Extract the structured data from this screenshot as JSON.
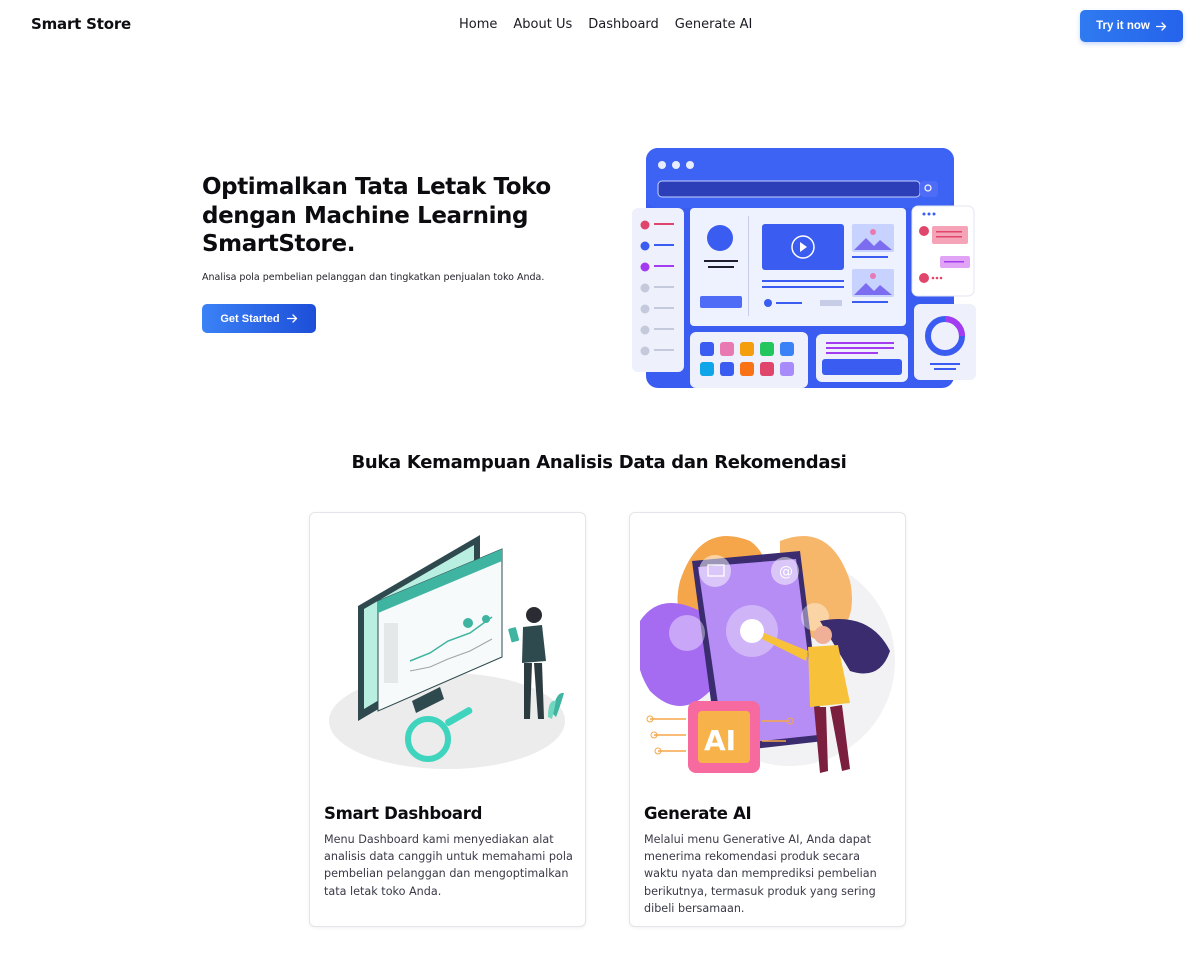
{
  "nav": {
    "brand": "Smart Store",
    "links": [
      "Home",
      "About Us",
      "Dashboard",
      "Generate AI"
    ],
    "cta_label": "Try it now",
    "cta_icon": "arrow-right-icon"
  },
  "hero": {
    "title": "Optimalkan Tata Letak Toko dengan Machine Learning SmartStore.",
    "subtitle": "Analisa pola pembelian pelanggan dan tingkatkan penjualan toko Anda.",
    "button_label": "Get Started",
    "button_icon": "arrow-right-icon",
    "illustration": "dashboard-ui-illustration"
  },
  "features": {
    "title": "Buka Kemampuan Analisis Data dan Rekomendasi",
    "cards": [
      {
        "title": "Smart Dashboard",
        "text": "Menu Dashboard kami menyediakan alat analisis data canggih untuk memahami pola pembelian pelanggan dan mengoptimalkan tata letak toko Anda.",
        "illustration": "analytics-dashboard-illustration"
      },
      {
        "title": "Generate AI",
        "text": "Melalui menu Generative AI, Anda dapat menerima rekomendasi produk secara waktu nyata dan memprediksi pembelian berikutnya, termasuk produk yang sering dibeli bersamaan.",
        "illustration": "ai-phone-illustration",
        "ai_badge": "AI"
      }
    ]
  },
  "colors": {
    "primary": "#2563eb",
    "text": "#0b0b10",
    "muted": "#3a3a48"
  }
}
